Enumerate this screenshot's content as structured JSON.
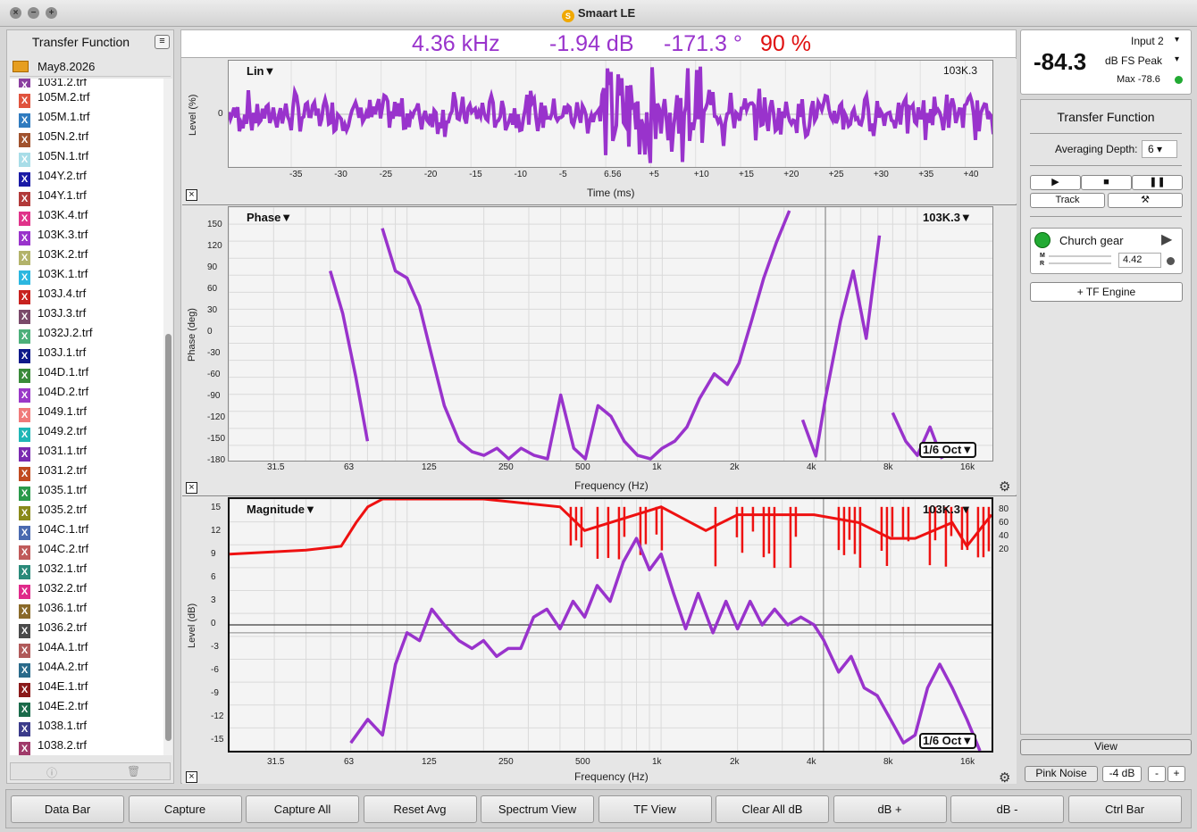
{
  "app": {
    "title": "Smaart LE",
    "logo": "S"
  },
  "window_controls": [
    {
      "glyph": "×"
    },
    {
      "glyph": "−"
    },
    {
      "glyph": "+"
    }
  ],
  "left": {
    "title": "Transfer Function",
    "menu_icon": "≡",
    "folder": "May8.2026",
    "files": [
      {
        "name": "1031.2.trf",
        "color": "#8a3ea0"
      },
      {
        "name": "105M.2.trf",
        "color": "#e0533d"
      },
      {
        "name": "105M.1.trf",
        "color": "#2f7bbf"
      },
      {
        "name": "105N.2.trf",
        "color": "#a0522d"
      },
      {
        "name": "105N.1.trf",
        "color": "#a8dde8"
      },
      {
        "name": "104Y.2.trf",
        "color": "#1a1aa6"
      },
      {
        "name": "104Y.1.trf",
        "color": "#b23a3a"
      },
      {
        "name": "103K.4.trf",
        "color": "#e0338a"
      },
      {
        "name": "103K.3.trf",
        "color": "#9933cc"
      },
      {
        "name": "103K.2.trf",
        "color": "#b3b36a"
      },
      {
        "name": "103K.1.trf",
        "color": "#2bb7e0"
      },
      {
        "name": "103J.4.trf",
        "color": "#c8221f"
      },
      {
        "name": "103J.3.trf",
        "color": "#7a4a6a"
      },
      {
        "name": "1032J.2.trf",
        "color": "#4caf7a"
      },
      {
        "name": "103J.1.trf",
        "color": "#0f1a8a"
      },
      {
        "name": "104D.1.trf",
        "color": "#3a8a3a"
      },
      {
        "name": "104D.2.trf",
        "color": "#9a38c8"
      },
      {
        "name": "1049.1.trf",
        "color": "#f07a7a"
      },
      {
        "name": "1049.2.trf",
        "color": "#1fb6b6"
      },
      {
        "name": "1031.1.trf",
        "color": "#7a2ab0"
      },
      {
        "name": "1031.2.trf",
        "color": "#c04a20"
      },
      {
        "name": "1035.1.trf",
        "color": "#2a9a4a"
      },
      {
        "name": "1035.2.trf",
        "color": "#8a8a1a"
      },
      {
        "name": "104C.1.trf",
        "color": "#4a6ab0"
      },
      {
        "name": "104C.2.trf",
        "color": "#c05a5a"
      },
      {
        "name": "1032.1.trf",
        "color": "#2a8a7a"
      },
      {
        "name": "1032.2.trf",
        "color": "#e02a8a"
      },
      {
        "name": "1036.1.trf",
        "color": "#8a6a2a"
      },
      {
        "name": "1036.2.trf",
        "color": "#4a4a4a"
      },
      {
        "name": "104A.1.trf",
        "color": "#b05a5a"
      },
      {
        "name": "104A.2.trf",
        "color": "#2a6a8a"
      },
      {
        "name": "104E.1.trf",
        "color": "#8a1a1a"
      },
      {
        "name": "104E.2.trf",
        "color": "#1a6a4a"
      },
      {
        "name": "1038.1.trf",
        "color": "#3a3a8a"
      },
      {
        "name": "1038.2.trf",
        "color": "#a03a6a"
      }
    ],
    "footer": {
      "info_icon": "ⓘ",
      "trash_icon": "🗑"
    }
  },
  "databar": {
    "freq": "4.36 kHz",
    "mag": "-1.94 dB",
    "phase": "-171.3 °",
    "coherence": "90 %",
    "accent": "#9933cc",
    "coh_color": "#e01010"
  },
  "impulse": {
    "title": "Lin▼",
    "label": "103K.3",
    "ylabel": "Level (%)",
    "xlabel": "Time (ms)",
    "yticks": [
      "0"
    ],
    "xticks": [
      "-35",
      "-30",
      "-25",
      "-20",
      "-15",
      "-10",
      "-5",
      "6.56",
      "+5",
      "+10",
      "+15",
      "+20",
      "+25",
      "+30",
      "+35",
      "+40"
    ]
  },
  "phase": {
    "title": "Phase▼",
    "label": "103K.3▼",
    "ylabel": "Phase (deg)",
    "xlabel": "Frequency (Hz)",
    "yticks": [
      "150",
      "120",
      "90",
      "60",
      "30",
      "0",
      "-30",
      "-60",
      "-90",
      "-120",
      "-150",
      "-180"
    ],
    "xticks": [
      "31.5",
      "63",
      "125",
      "250",
      "500",
      "1k",
      "2k",
      "4k",
      "8k",
      "16k"
    ],
    "octave": "1/6 Oct▼"
  },
  "magnitude": {
    "title": "Magnitude▼",
    "label": "103K.3▼",
    "ylabel": "Level (dB)",
    "xlabel": "Frequency (Hz)",
    "yticks": [
      "15",
      "12",
      "9",
      "6",
      "3",
      "0",
      "-3",
      "-6",
      "-9",
      "-12",
      "-15"
    ],
    "xticks": [
      "31.5",
      "63",
      "125",
      "250",
      "500",
      "1k",
      "2k",
      "4k",
      "8k",
      "16k"
    ],
    "coh_ticks": [
      "80",
      "60",
      "40",
      "20"
    ],
    "octave": "1/6 Oct▼"
  },
  "meter": {
    "input": "Input 2",
    "value": "-84.3",
    "mode": "dB FS Peak",
    "max": "Max -78.6",
    "status_color": "#22aa33"
  },
  "side": {
    "title": "Transfer Function",
    "avg_label": "Averaging Depth:",
    "avg_value": "6",
    "play": "▶",
    "stop": "■",
    "pause": "❚❚",
    "track": "Track",
    "tools_icon": "⚒",
    "engine_name": "Church gear",
    "m_label": "M",
    "r_label": "R",
    "delay": "4.42",
    "add_engine": "+ TF Engine",
    "view": "View",
    "pink_noise": "Pink Noise",
    "noise_level": "-4 dB",
    "minus": "-",
    "plus": "+"
  },
  "bottom": [
    "Data Bar",
    "Capture",
    "Capture All",
    "Reset Avg",
    "Spectrum View",
    "TF View",
    "Clear All dB",
    "dB +",
    "dB -",
    "Ctrl Bar"
  ],
  "chart_data": [
    {
      "type": "line",
      "title": "Phase",
      "series": [
        {
          "name": "103K.3",
          "color": "#9933cc",
          "x": [
            50,
            56,
            63,
            70,
            80,
            90,
            100,
            112,
            125,
            140,
            160,
            180,
            200,
            225,
            250,
            280,
            315,
            355,
            400,
            450,
            500,
            560,
            630,
            710,
            800,
            900,
            1000,
            1120,
            1250,
            1400,
            1600,
            1800,
            2000,
            2240,
            2500,
            2800,
            3150,
            3550,
            4000,
            4360,
            5000,
            5600,
            6300,
            7100,
            8000,
            9000,
            10000,
            11200,
            12500,
            14000,
            16000,
            18000
          ],
          "y": [
            90,
            30,
            -60,
            -150,
            150,
            90,
            80,
            40,
            -30,
            -100,
            -150,
            -165,
            -170,
            -160,
            -175,
            -160,
            -170,
            -175,
            -85,
            -160,
            -175,
            -100,
            -115,
            -150,
            -170,
            -175,
            -160,
            -150,
            -130,
            -90,
            -55,
            -70,
            -40,
            20,
            80,
            130,
            175,
            -120,
            -171,
            -90,
            20,
            90,
            -5,
            140,
            -110,
            -150,
            -170,
            -130,
            -175,
            180,
            -100,
            100
          ]
        }
      ],
      "ylim": [
        -180,
        180
      ],
      "xscale": "log"
    },
    {
      "type": "line",
      "title": "Magnitude",
      "series": [
        {
          "name": "103K.3",
          "color": "#9933cc",
          "x": [
            60,
            70,
            80,
            90,
            100,
            112,
            125,
            140,
            160,
            180,
            200,
            225,
            250,
            280,
            315,
            355,
            400,
            450,
            500,
            560,
            630,
            710,
            800,
            900,
            1000,
            1120,
            1250,
            1400,
            1600,
            1800,
            2000,
            2240,
            2500,
            2800,
            3150,
            3550,
            4000,
            4360,
            5000,
            5600,
            6300,
            7100,
            8000,
            9000,
            10000,
            11200,
            12500,
            14000,
            16000,
            18000
          ],
          "y": [
            -15,
            -12,
            -14,
            -5,
            -1,
            -2,
            2,
            0,
            -2,
            -3,
            -2,
            -4,
            -3,
            -3,
            1,
            2,
            -0.5,
            3,
            1,
            5,
            3,
            8,
            11,
            7,
            9,
            4,
            -0.5,
            4,
            -1,
            3,
            -0.5,
            3,
            0,
            2,
            0,
            1,
            0,
            -1.9,
            -6,
            -4,
            -8,
            -9,
            -12,
            -15,
            -14,
            -8,
            -5,
            -8,
            -12,
            -16
          ]
        },
        {
          "name": "coherence",
          "color": "#ee1111",
          "x": [
            20,
            40,
            55,
            63,
            70,
            80,
            100,
            200,
            400,
            500,
            1000,
            1500,
            2000,
            3000,
            4000,
            6000,
            8000,
            10000,
            14000,
            16000,
            20000
          ],
          "y": [
            9,
            9.5,
            10,
            13,
            15,
            16,
            16,
            16,
            15,
            12,
            15,
            12,
            14,
            14,
            14,
            13,
            11,
            11,
            13,
            10,
            14
          ]
        }
      ],
      "ylim": [
        -16,
        16
      ],
      "xscale": "log"
    }
  ]
}
